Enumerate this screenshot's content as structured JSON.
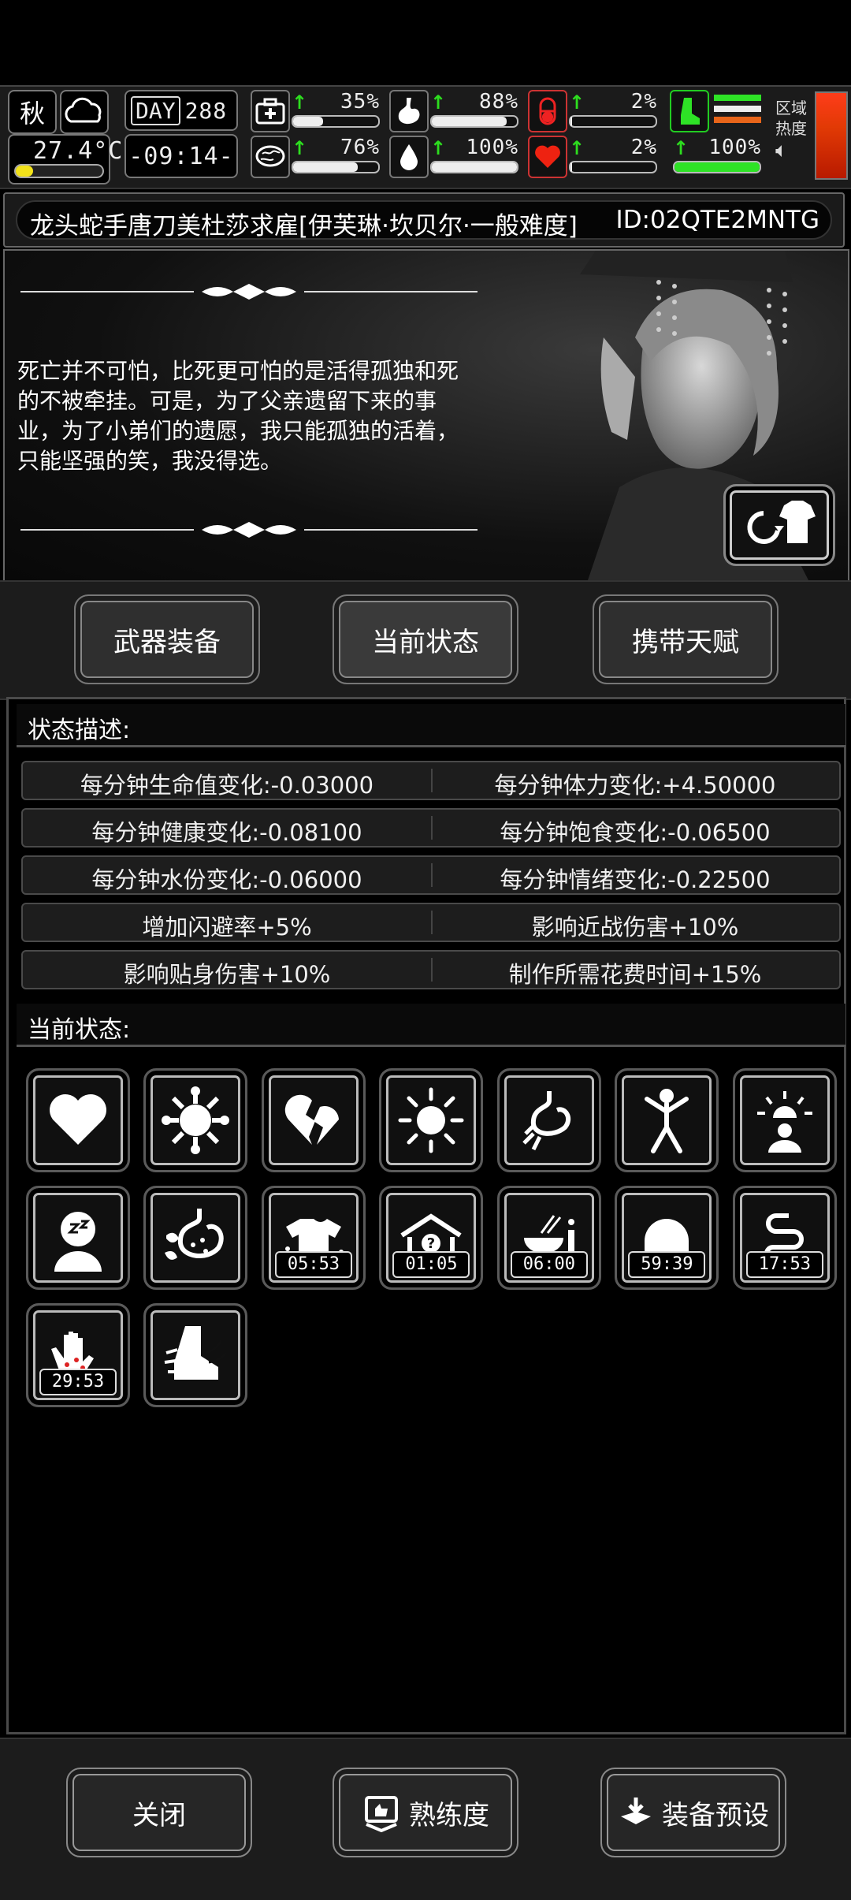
{
  "hud": {
    "season": "秋",
    "temperature": "27.4°C",
    "temperature_level": 0.2,
    "day_label": "DAY",
    "day_value": "288",
    "clock": "-09:14-",
    "zone_heat_label_1": "区域",
    "zone_heat_label_2": "热度",
    "stats": [
      {
        "icon": "medkit-icon",
        "value": "35%",
        "level": 0.35
      },
      {
        "icon": "stomach-icon",
        "value": "88%",
        "level": 0.88
      },
      {
        "icon": "pill-icon",
        "value": "2%",
        "level": 0.02
      },
      {
        "icon": "brain-icon",
        "value": "76%",
        "level": 0.76
      },
      {
        "icon": "water-drop-icon",
        "value": "100%",
        "level": 1.0
      },
      {
        "icon": "heart-icon",
        "value": "2%",
        "level": 0.02
      },
      {
        "icon": "boot-icon",
        "value": "100%",
        "level": 1.0
      }
    ]
  },
  "header": {
    "title": "龙头蛇手唐刀美杜莎求雇[伊芙琳·坎贝尔·一般难度]",
    "id": "ID:02QTE2MNTG"
  },
  "banner": {
    "quote": "死亡并不可怕，比死更可怕的是活得孤独和死的不被牵挂。可是，为了父亲遗留下来的事业，为了小弟们的遗愿，我只能孤独的活着，只能坚强的笑，我没得选。"
  },
  "tabs": {
    "weapons": "武器装备",
    "status": "当前状态",
    "talents": "携带天赋"
  },
  "status_desc": {
    "heading": "状态描述:",
    "rows": [
      [
        "每分钟生命值变化:-0.03000",
        "每分钟体力变化:+4.50000"
      ],
      [
        "每分钟健康变化:-0.08100",
        "每分钟饱食变化:-0.06500"
      ],
      [
        "每分钟水份变化:-0.06000",
        "每分钟情绪变化:-0.22500"
      ],
      [
        "增加闪避率+5%",
        "影响近战伤害+10%"
      ],
      [
        "影响贴身伤害+10%",
        "制作所需花费时间+15%"
      ]
    ]
  },
  "current_status": {
    "heading": "当前状态:",
    "icons": [
      {
        "name": "heart-icon",
        "timer": ""
      },
      {
        "name": "virus-icon",
        "timer": ""
      },
      {
        "name": "broken-heart-icon",
        "timer": ""
      },
      {
        "name": "sun-icon",
        "timer": ""
      },
      {
        "name": "stomach-leaf-icon",
        "timer": ""
      },
      {
        "name": "stick-figure-icon",
        "timer": ""
      },
      {
        "name": "alarm-person-icon",
        "timer": ""
      },
      {
        "name": "dizzy-head-icon",
        "timer": ""
      },
      {
        "name": "sick-stomach-icon",
        "timer": ""
      },
      {
        "name": "wet-shirt-icon",
        "timer": "05:53"
      },
      {
        "name": "house-question-icon",
        "timer": "01:05"
      },
      {
        "name": "meal-icon",
        "timer": "06:00"
      },
      {
        "name": "head-silhouette-icon",
        "timer": "59:39"
      },
      {
        "name": "intestine-icon",
        "timer": "17:53"
      },
      {
        "name": "infected-hand-icon",
        "timer": "29:53"
      },
      {
        "name": "swift-foot-icon",
        "timer": ""
      }
    ]
  },
  "footer": {
    "close": "关闭",
    "proficiency": "熟练度",
    "preset": "装备预设"
  }
}
